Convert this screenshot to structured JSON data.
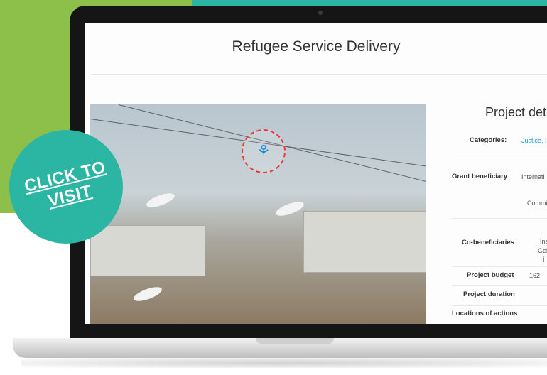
{
  "site": {
    "title": "Refugee Service Delivery"
  },
  "details": {
    "heading": "Project detai",
    "rows": [
      {
        "label": "Categories:",
        "value": "Justice, I",
        "link": true
      },
      {
        "label": "Grant beneficiary",
        "value": "Internati",
        "value2": "Commiss"
      },
      {
        "label": "Co-beneficiaries",
        "value": "İns",
        "value2": "Geli",
        "value3": "İ"
      },
      {
        "label": "Project budget",
        "value": "162"
      },
      {
        "label": "Project duration",
        "value": ""
      },
      {
        "label": "Locations of actions",
        "value": ""
      }
    ]
  },
  "cta": {
    "line1": "CLICK TO",
    "line2": "VISIT"
  },
  "colors": {
    "green": "#8cc04b",
    "teal": "#2bb6a3",
    "link": "#16a0d9"
  }
}
